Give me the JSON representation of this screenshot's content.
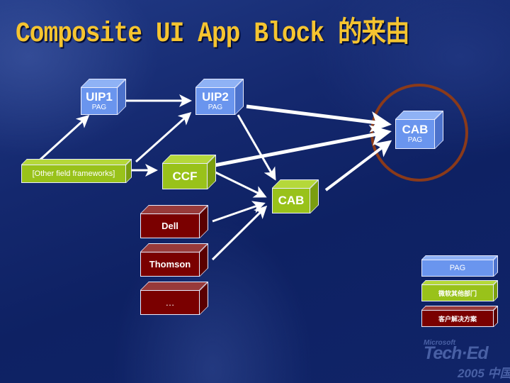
{
  "slide": {
    "title": "Composite UI App Block 的来由"
  },
  "nodes": {
    "uip1": {
      "label": "UIP1",
      "sublabel": "PAG",
      "category": "PAG"
    },
    "uip2": {
      "label": "UIP2",
      "sublabel": "PAG",
      "category": "PAG"
    },
    "cab_pag": {
      "label": "CAB",
      "sublabel": "PAG",
      "category": "PAG",
      "highlighted": true
    },
    "other_frameworks": {
      "label": "[Other field frameworks]",
      "category": "微软其他部门"
    },
    "ccf": {
      "label": "CCF",
      "category": "微软其他部门"
    },
    "cab_other": {
      "label": "CAB",
      "category": "微软其他部门"
    },
    "dell": {
      "label": "Dell",
      "category": "客户解决方案"
    },
    "thomson": {
      "label": "Thomson",
      "category": "客户解决方案"
    },
    "etc": {
      "label": "…",
      "category": "客户解决方案"
    }
  },
  "edges": [
    {
      "from": "uip1",
      "to": "uip2"
    },
    {
      "from": "other_frameworks",
      "to": "uip1"
    },
    {
      "from": "other_frameworks",
      "to": "uip2"
    },
    {
      "from": "other_frameworks",
      "to": "ccf"
    },
    {
      "from": "uip2",
      "to": "cab_pag"
    },
    {
      "from": "uip2",
      "to": "cab_other"
    },
    {
      "from": "ccf",
      "to": "cab_pag"
    },
    {
      "from": "ccf",
      "to": "cab_other"
    },
    {
      "from": "cab_other",
      "to": "cab_pag"
    },
    {
      "from": "dell",
      "to": "cab_other"
    },
    {
      "from": "thomson",
      "to": "cab_other"
    }
  ],
  "legend": [
    {
      "label": "PAG",
      "color": "#6a95ee"
    },
    {
      "label": "微软其他部门",
      "color": "#99c21a"
    },
    {
      "label": "客户解决方案",
      "color": "#7a0000"
    }
  ],
  "colors": {
    "title": "#f5c430",
    "highlight_circle": "#8a3a1a",
    "arrow": "#ffffff"
  },
  "logo": {
    "brand": "Microsoft",
    "event": "Tech·Ed",
    "edition": "2005 中国"
  }
}
